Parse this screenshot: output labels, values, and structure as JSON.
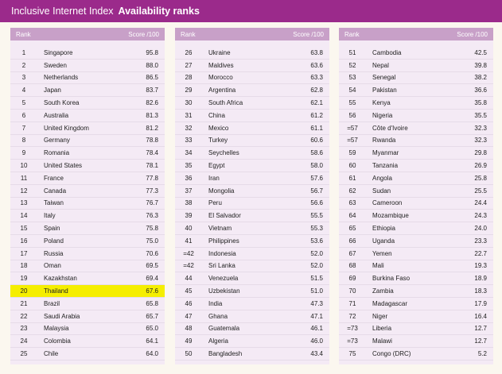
{
  "header": {
    "index": "Inclusive Internet Index",
    "title": "Availability ranks"
  },
  "columns": {
    "rank": "Rank",
    "score": "Score /100"
  },
  "tables": [
    {
      "rows": [
        {
          "rank": "1",
          "name": "Singapore",
          "score": "95.8"
        },
        {
          "rank": "2",
          "name": "Sweden",
          "score": "88.0"
        },
        {
          "rank": "3",
          "name": "Netherlands",
          "score": "86.5"
        },
        {
          "rank": "4",
          "name": "Japan",
          "score": "83.7"
        },
        {
          "rank": "5",
          "name": "South Korea",
          "score": "82.6"
        },
        {
          "rank": "6",
          "name": "Australia",
          "score": "81.3"
        },
        {
          "rank": "7",
          "name": "United Kingdom",
          "score": "81.2"
        },
        {
          "rank": "8",
          "name": "Germany",
          "score": "78.8"
        },
        {
          "rank": "9",
          "name": "Romania",
          "score": "78.4"
        },
        {
          "rank": "10",
          "name": "United States",
          "score": "78.1"
        },
        {
          "rank": "11",
          "name": "France",
          "score": "77.8"
        },
        {
          "rank": "12",
          "name": "Canada",
          "score": "77.3"
        },
        {
          "rank": "13",
          "name": "Taiwan",
          "score": "76.7"
        },
        {
          "rank": "14",
          "name": "Italy",
          "score": "76.3"
        },
        {
          "rank": "15",
          "name": "Spain",
          "score": "75.8"
        },
        {
          "rank": "16",
          "name": "Poland",
          "score": "75.0"
        },
        {
          "rank": "17",
          "name": "Russia",
          "score": "70.6"
        },
        {
          "rank": "18",
          "name": "Oman",
          "score": "69.5"
        },
        {
          "rank": "19",
          "name": "Kazakhstan",
          "score": "69.4"
        },
        {
          "rank": "20",
          "name": "Thailand",
          "score": "67.6",
          "highlight": true
        },
        {
          "rank": "21",
          "name": "Brazil",
          "score": "65.8"
        },
        {
          "rank": "22",
          "name": "Saudi Arabia",
          "score": "65.7"
        },
        {
          "rank": "23",
          "name": "Malaysia",
          "score": "65.0"
        },
        {
          "rank": "24",
          "name": "Colombia",
          "score": "64.1"
        },
        {
          "rank": "25",
          "name": "Chile",
          "score": "64.0"
        }
      ]
    },
    {
      "rows": [
        {
          "rank": "26",
          "name": "Ukraine",
          "score": "63.8"
        },
        {
          "rank": "27",
          "name": "Maldives",
          "score": "63.6"
        },
        {
          "rank": "28",
          "name": "Morocco",
          "score": "63.3"
        },
        {
          "rank": "29",
          "name": "Argentina",
          "score": "62.8"
        },
        {
          "rank": "30",
          "name": "South Africa",
          "score": "62.1"
        },
        {
          "rank": "31",
          "name": "China",
          "score": "61.2"
        },
        {
          "rank": "32",
          "name": "Mexico",
          "score": "61.1"
        },
        {
          "rank": "33",
          "name": "Turkey",
          "score": "60.6"
        },
        {
          "rank": "34",
          "name": "Seychelles",
          "score": "58.6"
        },
        {
          "rank": "35",
          "name": "Egypt",
          "score": "58.0"
        },
        {
          "rank": "36",
          "name": "Iran",
          "score": "57.6"
        },
        {
          "rank": "37",
          "name": "Mongolia",
          "score": "56.7"
        },
        {
          "rank": "38",
          "name": "Peru",
          "score": "56.6"
        },
        {
          "rank": "39",
          "name": "El Salvador",
          "score": "55.5"
        },
        {
          "rank": "40",
          "name": "Vietnam",
          "score": "55.3"
        },
        {
          "rank": "41",
          "name": "Philippines",
          "score": "53.6"
        },
        {
          "rank": "=42",
          "name": "Indonesia",
          "score": "52.0"
        },
        {
          "rank": "=42",
          "name": "Sri Lanka",
          "score": "52.0"
        },
        {
          "rank": "44",
          "name": "Venezuela",
          "score": "51.5"
        },
        {
          "rank": "45",
          "name": "Uzbekistan",
          "score": "51.0"
        },
        {
          "rank": "46",
          "name": "India",
          "score": "47.3"
        },
        {
          "rank": "47",
          "name": "Ghana",
          "score": "47.1"
        },
        {
          "rank": "48",
          "name": "Guatemala",
          "score": "46.1"
        },
        {
          "rank": "49",
          "name": "Algeria",
          "score": "46.0"
        },
        {
          "rank": "50",
          "name": "Bangladesh",
          "score": "43.4"
        }
      ]
    },
    {
      "rows": [
        {
          "rank": "51",
          "name": "Cambodia",
          "score": "42.5"
        },
        {
          "rank": "52",
          "name": "Nepal",
          "score": "39.8"
        },
        {
          "rank": "53",
          "name": "Senegal",
          "score": "38.2"
        },
        {
          "rank": "54",
          "name": "Pakistan",
          "score": "36.6"
        },
        {
          "rank": "55",
          "name": "Kenya",
          "score": "35.8"
        },
        {
          "rank": "56",
          "name": "Nigeria",
          "score": "35.5"
        },
        {
          "rank": "=57",
          "name": "Côte d'Ivoire",
          "score": "32.3"
        },
        {
          "rank": "=57",
          "name": "Rwanda",
          "score": "32.3"
        },
        {
          "rank": "59",
          "name": "Myanmar",
          "score": "29.8"
        },
        {
          "rank": "60",
          "name": "Tanzania",
          "score": "26.9"
        },
        {
          "rank": "61",
          "name": "Angola",
          "score": "25.8"
        },
        {
          "rank": "62",
          "name": "Sudan",
          "score": "25.5"
        },
        {
          "rank": "63",
          "name": "Cameroon",
          "score": "24.4"
        },
        {
          "rank": "64",
          "name": "Mozambique",
          "score": "24.3"
        },
        {
          "rank": "65",
          "name": "Ethiopia",
          "score": "24.0"
        },
        {
          "rank": "66",
          "name": "Uganda",
          "score": "23.3"
        },
        {
          "rank": "67",
          "name": "Yemen",
          "score": "22.7"
        },
        {
          "rank": "68",
          "name": "Mali",
          "score": "19.3"
        },
        {
          "rank": "69",
          "name": "Burkina Faso",
          "score": "18.9"
        },
        {
          "rank": "70",
          "name": "Zambia",
          "score": "18.3"
        },
        {
          "rank": "71",
          "name": "Madagascar",
          "score": "17.9"
        },
        {
          "rank": "72",
          "name": "Niger",
          "score": "16.4"
        },
        {
          "rank": "=73",
          "name": "Liberia",
          "score": "12.7"
        },
        {
          "rank": "=73",
          "name": "Malawi",
          "score": "12.7"
        },
        {
          "rank": "75",
          "name": "Congo (DRC)",
          "score": "5.2"
        }
      ]
    }
  ],
  "colors": {
    "title_bg": "#9b2a8b",
    "header_bg": "#c8a0c8",
    "table_bg": "#f4eaf5",
    "highlight": "#f5ee00"
  }
}
